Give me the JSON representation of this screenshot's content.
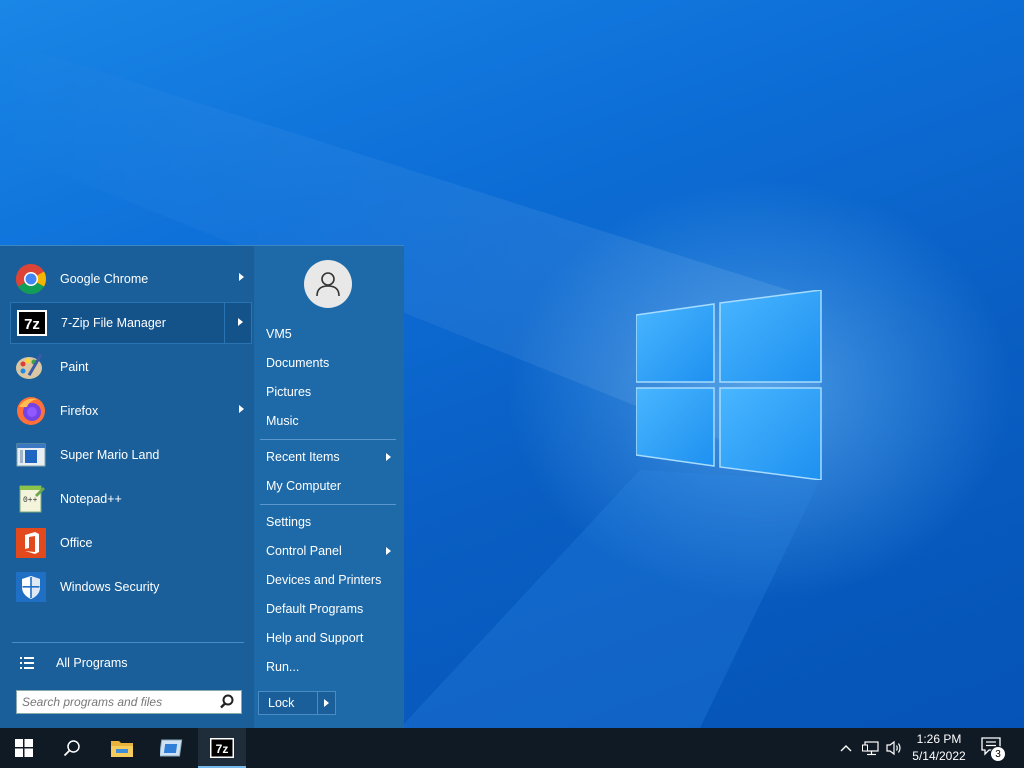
{
  "start_menu": {
    "programs": [
      {
        "label": "Google Chrome",
        "icon": "chrome-icon",
        "has_submenu": true
      },
      {
        "label": "7-Zip File Manager",
        "icon": "7zip-icon",
        "has_submenu": true
      },
      {
        "label": "Paint",
        "icon": "paint-icon",
        "has_submenu": false
      },
      {
        "label": "Firefox",
        "icon": "firefox-icon",
        "has_submenu": true
      },
      {
        "label": "Super Mario Land",
        "icon": "app-window-icon",
        "has_submenu": false
      },
      {
        "label": "Notepad++",
        "icon": "notepadpp-icon",
        "has_submenu": false
      },
      {
        "label": "Office",
        "icon": "office-icon",
        "has_submenu": false
      },
      {
        "label": "Windows Security",
        "icon": "shield-icon",
        "has_submenu": false
      }
    ],
    "all_programs_label": "All Programs",
    "search_placeholder": "Search programs and files",
    "right_items": {
      "user": "VM5",
      "documents": "Documents",
      "pictures": "Pictures",
      "music": "Music",
      "recent_items": "Recent Items",
      "my_computer": "My Computer",
      "settings": "Settings",
      "control_panel": "Control Panel",
      "devices_printers": "Devices and Printers",
      "default_programs": "Default Programs",
      "help_support": "Help and Support",
      "run": "Run..."
    },
    "lock_label": "Lock"
  },
  "taskbar": {
    "buttons": [
      "windows-start-icon",
      "search-icon",
      "file-explorer-icon",
      "app-window-icon",
      "7zip-icon"
    ],
    "active_button": "7zip-icon",
    "seven_zip_text": "7z",
    "time": "1:26 PM",
    "date": "5/14/2022",
    "notification_count": "3"
  },
  "colors": {
    "menu_left": "#1a5f99",
    "menu_right": "#1e6aa8",
    "taskbar": "#101a24",
    "desktop": "#0a63c9"
  }
}
